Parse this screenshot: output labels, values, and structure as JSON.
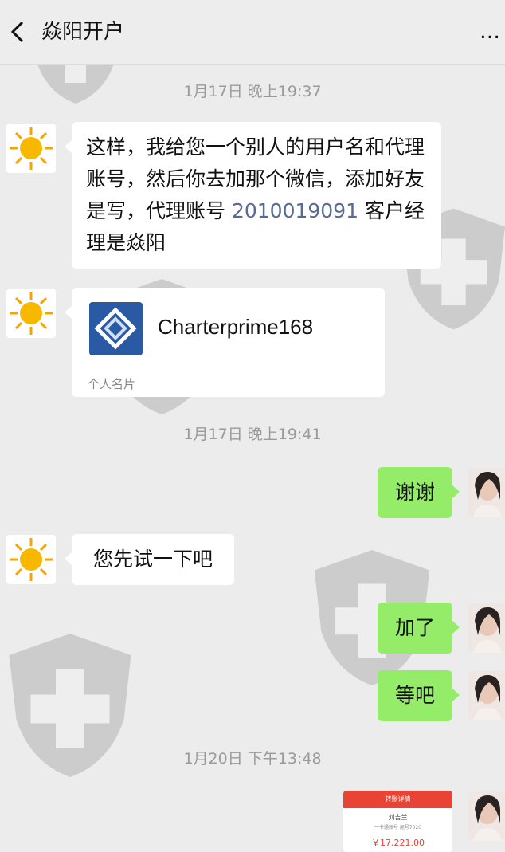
{
  "header": {
    "title": "焱阳开户",
    "more_glyph": "…"
  },
  "timestamps": [
    "1月17日 晚上19:37",
    "1月17日 晚上19:41",
    "1月20日 下午13:48"
  ],
  "messages": {
    "m1_before": "这样，我给您一个别人的用户名和代理账号，然后你去加那个微信，添加好友是写，代理账号 ",
    "m1_number": "2010019091",
    "m1_after": " 客户经理是焱阳",
    "card_name": "Charterprime168",
    "card_label": "个人名片",
    "m2": "谢谢",
    "m3": "您先试一下吧",
    "m4": "加了",
    "m5": "等吧"
  },
  "transfer": {
    "title": "转账详情",
    "name": "刘吉兰",
    "sub": "一卡通账号 尾号7020",
    "amount": "￥17,221.00"
  },
  "colors": {
    "bubble_me": "#95ec69",
    "bubble_other": "#ffffff",
    "background": "#ececec",
    "link": "#576b95",
    "transfer_red": "#e94335"
  }
}
